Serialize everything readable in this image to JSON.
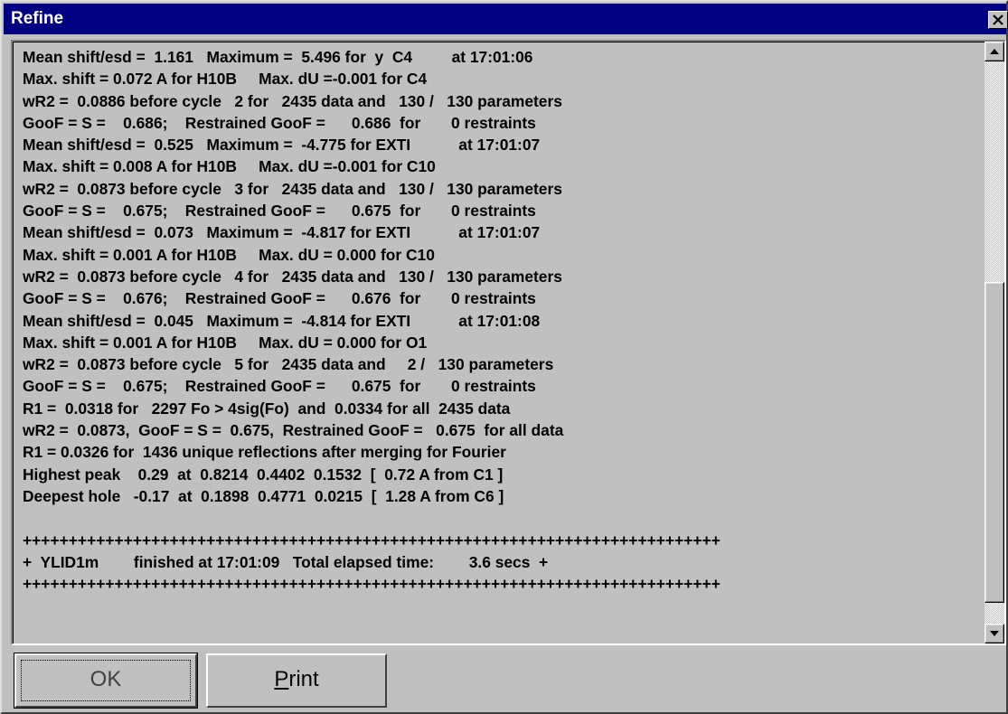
{
  "window": {
    "title": "Refine",
    "close_symbol": "×"
  },
  "log": {
    "lines": [
      "Mean shift/esd =  1.161   Maximum =  5.496 for  y  C4         at 17:01:06",
      "Max. shift = 0.072 A for H10B     Max. dU =-0.001 for C4",
      "wR2 =  0.0886 before cycle   2 for   2435 data and   130 /   130 parameters",
      "GooF = S =    0.686;    Restrained GooF =      0.686  for       0 restraints",
      "Mean shift/esd =  0.525   Maximum =  -4.775 for EXTI           at 17:01:07",
      "Max. shift = 0.008 A for H10B     Max. dU =-0.001 for C10",
      "wR2 =  0.0873 before cycle   3 for   2435 data and   130 /   130 parameters",
      "GooF = S =    0.675;    Restrained GooF =      0.675  for       0 restraints",
      "Mean shift/esd =  0.073   Maximum =  -4.817 for EXTI           at 17:01:07",
      "Max. shift = 0.001 A for H10B     Max. dU = 0.000 for C10",
      "wR2 =  0.0873 before cycle   4 for   2435 data and   130 /   130 parameters",
      "GooF = S =    0.676;    Restrained GooF =      0.676  for       0 restraints",
      "Mean shift/esd =  0.045   Maximum =  -4.814 for EXTI           at 17:01:08",
      "Max. shift = 0.001 A for H10B     Max. dU = 0.000 for O1",
      "wR2 =  0.0873 before cycle   5 for   2435 data and     2 /   130 parameters",
      "GooF = S =    0.675;    Restrained GooF =      0.675  for       0 restraints",
      "R1 =  0.0318 for   2297 Fo > 4sig(Fo)  and  0.0334 for all  2435 data",
      "wR2 =  0.0873,  GooF = S =  0.675,  Restrained GooF =   0.675  for all data",
      "R1 = 0.0326 for  1436 unique reflections after merging for Fourier",
      "Highest peak    0.29  at  0.8214  0.4402  0.1532  [  0.72 A from C1 ]",
      "Deepest hole   -0.17  at  0.1898  0.4771  0.0215  [  1.28 A from C6 ]",
      "",
      "++++++++++++++++++++++++++++++++++++++++++++++++++++++++++++++++++++++++++++",
      "+  YLID1m        finished at 17:01:09   Total elapsed time:        3.6 secs  +",
      "++++++++++++++++++++++++++++++++++++++++++++++++++++++++++++++++++++++++++++"
    ]
  },
  "buttons": {
    "ok_label": "OK",
    "print_mnemonic": "P",
    "print_rest": "rint"
  },
  "colors": {
    "title_bar": "#000080",
    "face": "#c0c0c0"
  }
}
